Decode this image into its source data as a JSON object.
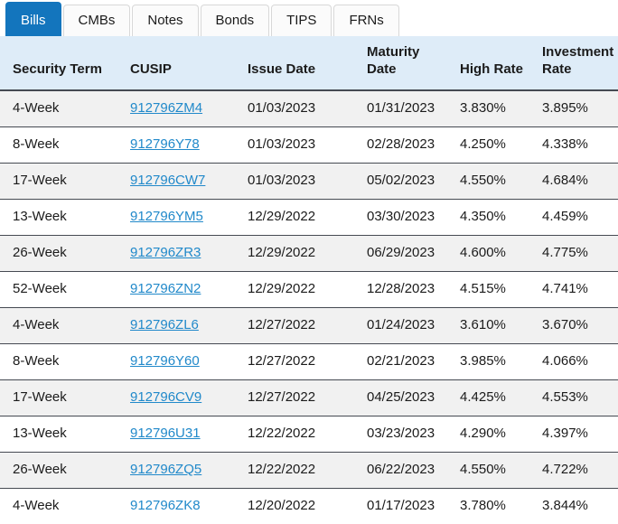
{
  "tabs": [
    {
      "label": "Bills",
      "active": true
    },
    {
      "label": "CMBs",
      "active": false
    },
    {
      "label": "Notes",
      "active": false
    },
    {
      "label": "Bonds",
      "active": false
    },
    {
      "label": "TIPS",
      "active": false
    },
    {
      "label": "FRNs",
      "active": false
    }
  ],
  "table": {
    "columns": [
      {
        "key": "security_term",
        "label": "Security Term"
      },
      {
        "key": "cusip",
        "label": "CUSIP"
      },
      {
        "key": "issue_date",
        "label": "Issue Date"
      },
      {
        "key": "maturity_date",
        "label": "Maturity Date"
      },
      {
        "key": "high_rate",
        "label": "High Rate"
      },
      {
        "key": "investment_rate",
        "label": "Investment Rate"
      }
    ],
    "rows": [
      {
        "security_term": "4-Week",
        "cusip": "912796ZM4",
        "cusip_underlined": true,
        "issue_date": "01/03/2023",
        "maturity_date": "01/31/2023",
        "high_rate": "3.830%",
        "investment_rate": "3.895%"
      },
      {
        "security_term": "8-Week",
        "cusip": "912796Y78",
        "cusip_underlined": true,
        "issue_date": "01/03/2023",
        "maturity_date": "02/28/2023",
        "high_rate": "4.250%",
        "investment_rate": "4.338%"
      },
      {
        "security_term": "17-Week",
        "cusip": "912796CW7",
        "cusip_underlined": true,
        "issue_date": "01/03/2023",
        "maturity_date": "05/02/2023",
        "high_rate": "4.550%",
        "investment_rate": "4.684%"
      },
      {
        "security_term": "13-Week",
        "cusip": "912796YM5",
        "cusip_underlined": true,
        "issue_date": "12/29/2022",
        "maturity_date": "03/30/2023",
        "high_rate": "4.350%",
        "investment_rate": "4.459%"
      },
      {
        "security_term": "26-Week",
        "cusip": "912796ZR3",
        "cusip_underlined": true,
        "issue_date": "12/29/2022",
        "maturity_date": "06/29/2023",
        "high_rate": "4.600%",
        "investment_rate": "4.775%"
      },
      {
        "security_term": "52-Week",
        "cusip": "912796ZN2",
        "cusip_underlined": true,
        "issue_date": "12/29/2022",
        "maturity_date": "12/28/2023",
        "high_rate": "4.515%",
        "investment_rate": "4.741%"
      },
      {
        "security_term": "4-Week",
        "cusip": "912796ZL6",
        "cusip_underlined": true,
        "issue_date": "12/27/2022",
        "maturity_date": "01/24/2023",
        "high_rate": "3.610%",
        "investment_rate": "3.670%"
      },
      {
        "security_term": "8-Week",
        "cusip": "912796Y60",
        "cusip_underlined": true,
        "issue_date": "12/27/2022",
        "maturity_date": "02/21/2023",
        "high_rate": "3.985%",
        "investment_rate": "4.066%"
      },
      {
        "security_term": "17-Week",
        "cusip": "912796CV9",
        "cusip_underlined": true,
        "issue_date": "12/27/2022",
        "maturity_date": "04/25/2023",
        "high_rate": "4.425%",
        "investment_rate": "4.553%"
      },
      {
        "security_term": "13-Week",
        "cusip": "912796U31",
        "cusip_underlined": true,
        "issue_date": "12/22/2022",
        "maturity_date": "03/23/2023",
        "high_rate": "4.290%",
        "investment_rate": "4.397%"
      },
      {
        "security_term": "26-Week",
        "cusip": "912796ZQ5",
        "cusip_underlined": true,
        "issue_date": "12/22/2022",
        "maturity_date": "06/22/2023",
        "high_rate": "4.550%",
        "investment_rate": "4.722%"
      },
      {
        "security_term": "4-Week",
        "cusip": "912796ZK8",
        "cusip_underlined": false,
        "issue_date": "12/20/2022",
        "maturity_date": "01/17/2023",
        "high_rate": "3.780%",
        "investment_rate": "3.844%"
      }
    ]
  },
  "colors": {
    "active_tab": "#1375bd",
    "header_bg": "#deecf8",
    "alt_row_bg": "#f1f1f1",
    "link": "#2189ca",
    "row_border": "#454a52",
    "text": "#1b1b1b"
  }
}
